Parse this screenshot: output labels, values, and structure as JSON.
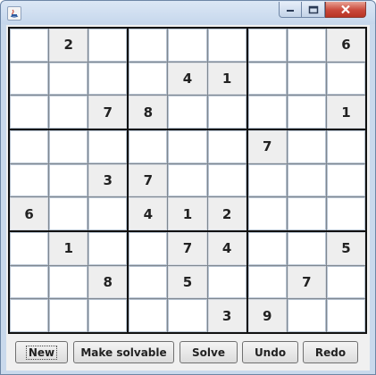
{
  "window": {
    "buttons": [
      "minimize",
      "maximize",
      "close"
    ]
  },
  "grid": [
    [
      "",
      "2",
      "",
      "",
      "",
      "",
      "",
      "",
      "6"
    ],
    [
      "",
      "",
      "",
      "",
      "4",
      "1",
      "",
      "",
      ""
    ],
    [
      "",
      "",
      "7",
      "8",
      "",
      "",
      "",
      "",
      "1"
    ],
    [
      "",
      "",
      "",
      "",
      "",
      "",
      "7",
      "",
      ""
    ],
    [
      "",
      "",
      "3",
      "7",
      "",
      "",
      "",
      "",
      ""
    ],
    [
      "6",
      "",
      "",
      "4",
      "1",
      "2",
      "",
      "",
      ""
    ],
    [
      "",
      "1",
      "",
      "",
      "7",
      "4",
      "",
      "",
      "5"
    ],
    [
      "",
      "",
      "8",
      "",
      "5",
      "",
      "",
      "7",
      ""
    ],
    [
      "",
      "",
      "",
      "",
      "",
      "3",
      "9",
      "",
      ""
    ]
  ],
  "toolbar": {
    "new_label": "New",
    "make_solvable_label": "Make solvable",
    "solve_label": "Solve",
    "undo_label": "Undo",
    "redo_label": "Redo"
  },
  "colors": {
    "given_cell": "#eeeeee",
    "empty_cell": "#ffffff",
    "box_border": "#111111"
  }
}
